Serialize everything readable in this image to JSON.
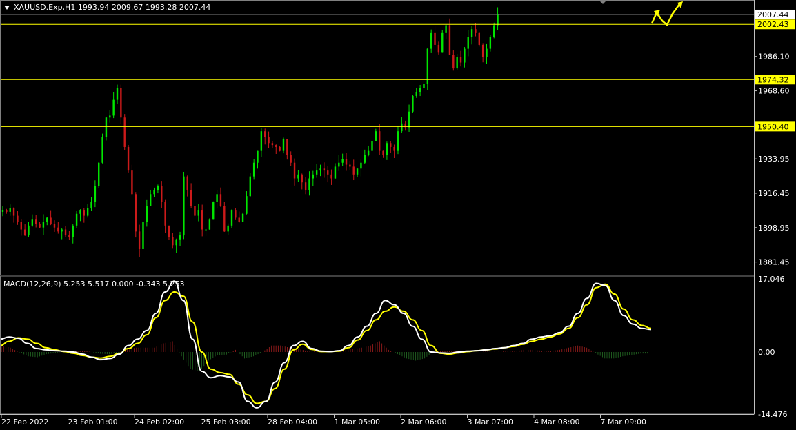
{
  "chart_data": [
    {
      "type": "candlestick",
      "title": "XAUUSD.Exp,H1",
      "ohlc": {
        "open": 1993.94,
        "high": 2009.67,
        "low": 1993.28,
        "close": 2007.44
      },
      "ylim": [
        1875,
        2012
      ],
      "price_ticks": [
        "1986.10",
        "1968.60",
        "1933.95",
        "1916.45",
        "1898.95",
        "1881.45"
      ],
      "current_price": {
        "value": 2007.44,
        "label": "2007.44"
      },
      "horizontal_lines": [
        {
          "value": 2002.43,
          "label": "2002.43"
        },
        {
          "value": 1974.32,
          "label": "1974.32"
        },
        {
          "value": 1950.4,
          "label": "1950.40"
        }
      ],
      "x_ticks": [
        "22 Feb 2022",
        "23 Feb 01:00",
        "24 Feb 02:00",
        "25 Feb 03:00",
        "28 Feb 04:00",
        "1 Mar 05:00",
        "2 Mar 06:00",
        "3 Mar 07:00",
        "4 Mar 08:00",
        "7 Mar 09:00"
      ],
      "close_path": [
        1908,
        1907,
        1909,
        1905,
        1902,
        1898,
        1895,
        1900,
        1903,
        1901,
        1899,
        1902,
        1904,
        1901,
        1899,
        1897,
        1898,
        1895,
        1894,
        1900,
        1906,
        1908,
        1905,
        1909,
        1912,
        1920,
        1932,
        1945,
        1955,
        1956,
        1964,
        1970,
        1955,
        1940,
        1928,
        1916,
        1897,
        1888,
        1902,
        1910,
        1916,
        1918,
        1920,
        1912,
        1900,
        1894,
        1890,
        1893,
        1895,
        1925,
        1918,
        1910,
        1905,
        1908,
        1898,
        1898,
        1903,
        1912,
        1916,
        1910,
        1897,
        1900,
        1908,
        1904,
        1902,
        1906,
        1915,
        1925,
        1932,
        1938,
        1948,
        1945,
        1942,
        1941,
        1940,
        1938,
        1944,
        1936,
        1932,
        1924,
        1926,
        1922,
        1918,
        1924,
        1926,
        1928,
        1929,
        1928,
        1926,
        1924,
        1930,
        1932,
        1934,
        1931,
        1930,
        1926,
        1929,
        1932,
        1936,
        1938,
        1943,
        1948,
        1938,
        1936,
        1942,
        1940,
        1938,
        1948,
        1952,
        1950,
        1958,
        1966,
        1968,
        1970,
        1972,
        1990,
        1998,
        1992,
        1988,
        1998,
        2002,
        1987,
        1980,
        1986,
        1983,
        1990,
        1996,
        2000,
        1998,
        1992,
        1986,
        1990,
        1996,
        2002,
        2007.44
      ],
      "projection_arrows": true
    },
    {
      "type": "macd",
      "label": "MACD(12,26,9) 5.253 5.517 0.000 -0.343 5.253",
      "ylim": [
        -14.476,
        17.046
      ],
      "ticks": [
        "17.046",
        "0.00",
        "-14.476"
      ],
      "macd_line": [
        3.0,
        3.5,
        3.2,
        2.0,
        0.8,
        0.5,
        0.3,
        0.2,
        0.0,
        -0.5,
        -1.2,
        -1.8,
        -1.5,
        -0.5,
        1.5,
        3.0,
        5.0,
        9.0,
        14.0,
        16.5,
        12.0,
        3.0,
        -4.5,
        -6.0,
        -5.5,
        -5.8,
        -7.0,
        -11.5,
        -13.0,
        -11.5,
        -7.0,
        -2.5,
        1.5,
        2.5,
        0.8,
        0.2,
        0.1,
        0.3,
        1.5,
        3.5,
        6.0,
        9.0,
        12.0,
        11.0,
        9.0,
        6.0,
        3.0,
        0.0,
        -0.2,
        -0.3,
        0.0,
        0.2,
        0.3,
        0.5,
        0.8,
        1.0,
        1.5,
        2.0,
        3.0,
        3.5,
        3.8,
        4.5,
        6.0,
        9.0,
        12.5,
        16.0,
        15.5,
        12.0,
        8.5,
        6.5,
        5.5,
        5.253
      ],
      "signal_line": [
        1.5,
        2.5,
        3.3,
        3.0,
        2.0,
        1.0,
        0.5,
        0.1,
        -0.3,
        -0.8,
        -1.2,
        -1.4,
        -1.0,
        -0.3,
        0.8,
        2.0,
        4.0,
        8.0,
        12.0,
        14.0,
        13.0,
        7.0,
        0.0,
        -4.0,
        -4.8,
        -5.2,
        -7.5,
        -10.0,
        -12.0,
        -11.5,
        -8.5,
        -4.0,
        0.5,
        1.8,
        0.6,
        0.1,
        0.1,
        0.2,
        1.0,
        2.8,
        5.0,
        7.5,
        9.5,
        10.5,
        9.5,
        7.5,
        5.0,
        1.5,
        -0.3,
        -0.5,
        -0.2,
        0.1,
        0.3,
        0.5,
        0.7,
        1.0,
        1.3,
        1.8,
        2.5,
        3.0,
        3.5,
        4.2,
        5.5,
        8.0,
        11.0,
        15.0,
        15.8,
        13.5,
        10.0,
        7.5,
        6.2,
        5.517
      ],
      "histogram": [
        1.5,
        1.0,
        -0.1,
        -1.0,
        -1.2,
        -0.5,
        -0.2,
        0.1,
        0.3,
        0.3,
        0.0,
        -0.4,
        -0.5,
        -0.2,
        0.7,
        1.0,
        1.0,
        1.0,
        2.0,
        2.5,
        -1.0,
        -4.0,
        -4.5,
        -2.0,
        -0.7,
        -0.6,
        0.5,
        -1.5,
        -1.0,
        0.0,
        1.5,
        1.5,
        1.0,
        0.7,
        0.2,
        0.1,
        0.0,
        0.1,
        0.5,
        0.7,
        1.0,
        1.5,
        2.5,
        0.5,
        -0.5,
        -1.5,
        -2.0,
        -1.5,
        0.1,
        0.2,
        0.2,
        0.1,
        0.0,
        0.0,
        0.1,
        0.0,
        0.2,
        0.2,
        0.5,
        0.5,
        0.3,
        0.3,
        0.5,
        1.0,
        1.5,
        1.0,
        -0.3,
        -1.5,
        -1.5,
        -1.0,
        -0.7,
        -0.343
      ]
    }
  ],
  "colors": {
    "background": "#000000",
    "bull": "#00e600",
    "bear": "#cc1a1a",
    "level_line": "#ffff00",
    "macd_line": "#ffffff",
    "signal_line": "#ffff00",
    "hist_pos": "#8b1a1a",
    "hist_neg": "#1f5c1f",
    "axis": "#c0c0c0",
    "grid_text": "#ffffff"
  }
}
